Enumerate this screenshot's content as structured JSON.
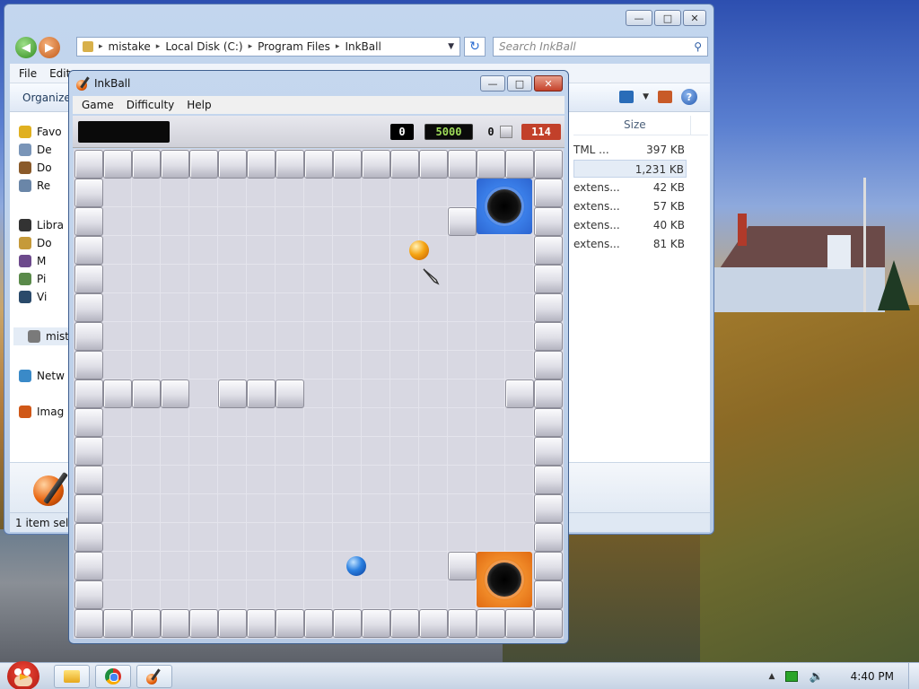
{
  "explorer": {
    "breadcrumb": [
      "mistake",
      "Local Disk (C:)",
      "Program Files",
      "InkBall"
    ],
    "search_placeholder": "Search InkBall",
    "menu": [
      "File",
      "Edit"
    ],
    "toolbar_organize": "Organize",
    "nav_items": [
      {
        "label": "Favo",
        "icon": "star-icon",
        "color": "#e0b020"
      },
      {
        "label": "De",
        "icon": "desktop-icon",
        "color": "#7a95b8"
      },
      {
        "label": "Do",
        "icon": "downloads-icon",
        "color": "#8a5a2a"
      },
      {
        "label": "Re",
        "icon": "recent-icon",
        "color": "#6a86a8"
      },
      {
        "label": "Libra",
        "icon": "libraries-icon",
        "color": "#333333"
      },
      {
        "label": "Do",
        "icon": "documents-icon",
        "color": "#c59a3a"
      },
      {
        "label": "M",
        "icon": "music-icon",
        "color": "#6d4a8c"
      },
      {
        "label": "Pi",
        "icon": "pictures-icon",
        "color": "#5a8a4a"
      },
      {
        "label": "Vi",
        "icon": "videos-icon",
        "color": "#2a4a6a"
      },
      {
        "label": "mist",
        "icon": "computer-icon",
        "color": "#7a7a7a"
      },
      {
        "label": "Netw",
        "icon": "network-icon",
        "color": "#3a8ac8"
      },
      {
        "label": "Imag",
        "icon": "image-app-icon",
        "color": "#d05818"
      }
    ],
    "column_size": "Size",
    "files": [
      {
        "type": "TML ...",
        "size": "397 KB"
      },
      {
        "type": "",
        "size": "1,231 KB"
      },
      {
        "type": "extens...",
        "size": "42 KB"
      },
      {
        "type": "extens...",
        "size": "57 KB"
      },
      {
        "type": "extens...",
        "size": "40 KB"
      },
      {
        "type": "extens...",
        "size": "81 KB"
      }
    ],
    "status": "1 item selec"
  },
  "inkball": {
    "title": "InkBall",
    "menu": [
      "Game",
      "Difficulty",
      "Help"
    ],
    "score_left": "0",
    "score_main": "5000",
    "count": "0",
    "timer": "114",
    "colors": {
      "blue_hole": "#3a7ee8",
      "orange_hole": "#f08a28",
      "timer_bg": "#c2402a",
      "score_fg": "#9fdc5a"
    }
  },
  "taskbar": {
    "clock": "4:40 PM",
    "apps": [
      "explorer-icon",
      "chrome-icon",
      "inkball-icon"
    ]
  }
}
